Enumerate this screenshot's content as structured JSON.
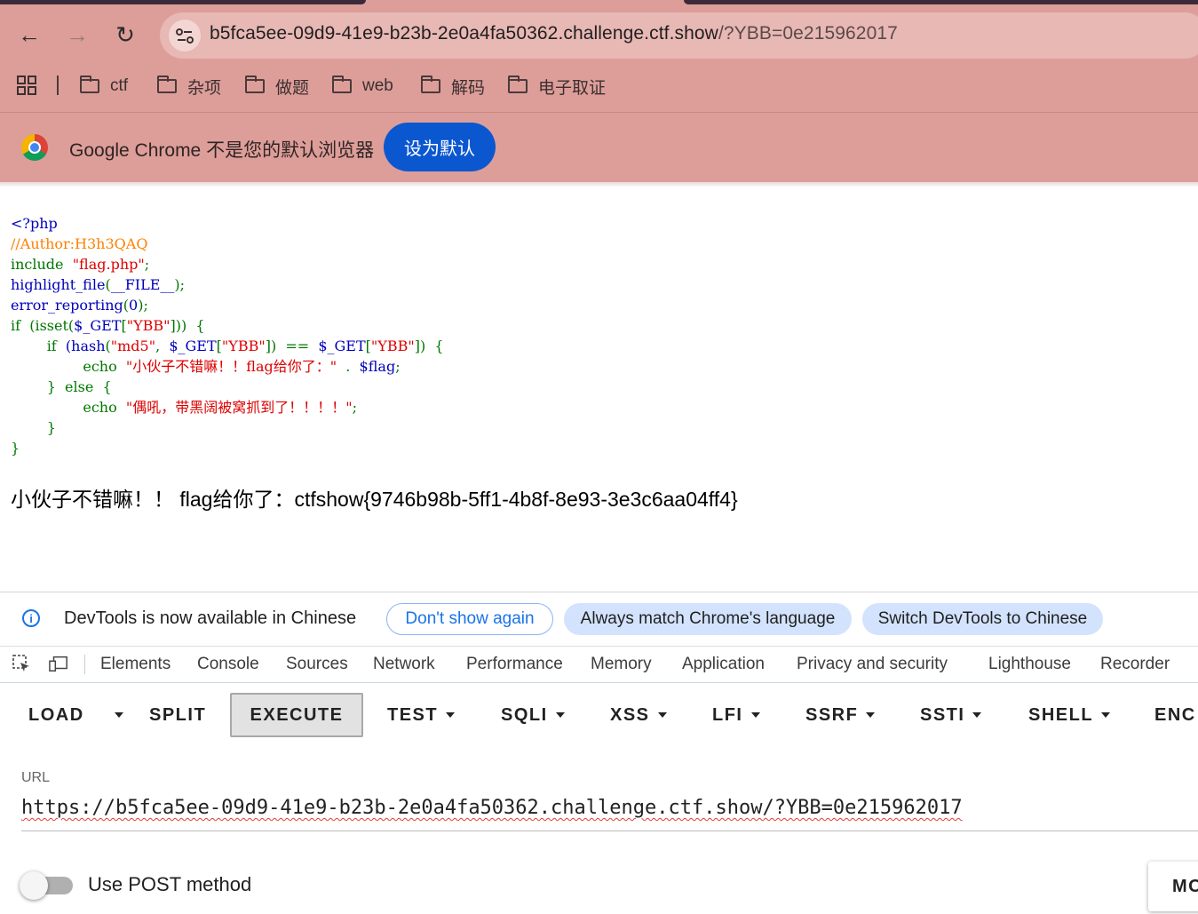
{
  "browser": {
    "url_host": "b5fca5ee-09d9-41e9-b23b-2e0a4fa50362.challenge.ctf.show",
    "url_path": "/?YBB=0e215962017",
    "bookmarks": [
      "ctf",
      "杂项",
      "做题",
      "web",
      "解码",
      "电子取证"
    ],
    "infobar_text": "Google Chrome 不是您的默认浏览器",
    "set_default_label": "设为默认"
  },
  "page": {
    "code_lines": [
      [
        {
          "t": "<?php",
          "c": "def"
        }
      ],
      [
        {
          "t": "//Author:H3h3QAQ",
          "c": "com"
        }
      ],
      [
        {
          "t": "include  ",
          "c": "kw"
        },
        {
          "t": "\"flag.php\"",
          "c": "str"
        },
        {
          "t": ";",
          "c": "kw"
        }
      ],
      [
        {
          "t": "highlight_file",
          "c": "def"
        },
        {
          "t": "(",
          "c": "kw"
        },
        {
          "t": "__FILE__",
          "c": "def"
        },
        {
          "t": ");",
          "c": "kw"
        }
      ],
      [
        {
          "t": "error_reporting",
          "c": "def"
        },
        {
          "t": "(",
          "c": "kw"
        },
        {
          "t": "0",
          "c": "def"
        },
        {
          "t": ");",
          "c": "kw"
        }
      ],
      [
        {
          "t": "if  ",
          "c": "kw"
        },
        {
          "t": "(isset",
          "c": "kw"
        },
        {
          "t": "(",
          "c": "kw"
        },
        {
          "t": "$_GET",
          "c": "def"
        },
        {
          "t": "[",
          "c": "kw"
        },
        {
          "t": "\"YBB\"",
          "c": "str"
        },
        {
          "t": "]))  {",
          "c": "kw"
        }
      ],
      [
        {
          "t": "        if  ",
          "c": "kw"
        },
        {
          "t": "(hash",
          "c": "def"
        },
        {
          "t": "(",
          "c": "kw"
        },
        {
          "t": "\"md5\"",
          "c": "str"
        },
        {
          "t": ",  ",
          "c": "kw"
        },
        {
          "t": "$_GET",
          "c": "def"
        },
        {
          "t": "[",
          "c": "kw"
        },
        {
          "t": "\"YBB\"",
          "c": "str"
        },
        {
          "t": "])  ==  ",
          "c": "kw"
        },
        {
          "t": "$_GET",
          "c": "def"
        },
        {
          "t": "[",
          "c": "kw"
        },
        {
          "t": "\"YBB\"",
          "c": "str"
        },
        {
          "t": "])  {",
          "c": "kw"
        }
      ],
      [
        {
          "t": "                echo  ",
          "c": "kw"
        },
        {
          "t": "\"小伙子不错嘛！！flag给你了：\"",
          "c": "str"
        },
        {
          "t": "  .  ",
          "c": "kw"
        },
        {
          "t": "$flag",
          "c": "def"
        },
        {
          "t": ";",
          "c": "kw"
        }
      ],
      [
        {
          "t": "        }  else  {",
          "c": "kw"
        }
      ],
      [
        {
          "t": "                echo  ",
          "c": "kw"
        },
        {
          "t": "\"偶吼，带黑阔被窝抓到了！！！！\"",
          "c": "str"
        },
        {
          "t": ";",
          "c": "kw"
        }
      ],
      [
        {
          "t": "        }",
          "c": "kw"
        }
      ],
      [
        {
          "t": "}",
          "c": "kw"
        }
      ]
    ],
    "output": "小伙子不错嘛！！ flag给你了：ctfshow{9746b98b-5ff1-4b8f-8e93-3e3c6aa04ff4}"
  },
  "devtools": {
    "notice": "DevTools is now available in Chinese",
    "dont_show": "Don't show again",
    "always_match": "Always match Chrome's language",
    "switch_chinese": "Switch DevTools to Chinese",
    "tabs": [
      "Elements",
      "Console",
      "Sources",
      "Network",
      "Performance",
      "Memory",
      "Application",
      "Privacy and security",
      "Lighthouse",
      "Recorder"
    ]
  },
  "hackbar": {
    "buttons": [
      "LOAD",
      "SPLIT",
      "EXECUTE",
      "TEST",
      "SQLI",
      "XSS",
      "LFI",
      "SSRF",
      "SSTI",
      "SHELL",
      "ENC"
    ],
    "url_label": "URL",
    "url_value": "https://b5fca5ee-09d9-41e9-b23b-2e0a4fa50362.challenge.ctf.show/?YBB=0e215962017",
    "post_label": "Use POST method",
    "mo_label": "MO",
    "post_enabled": false
  }
}
